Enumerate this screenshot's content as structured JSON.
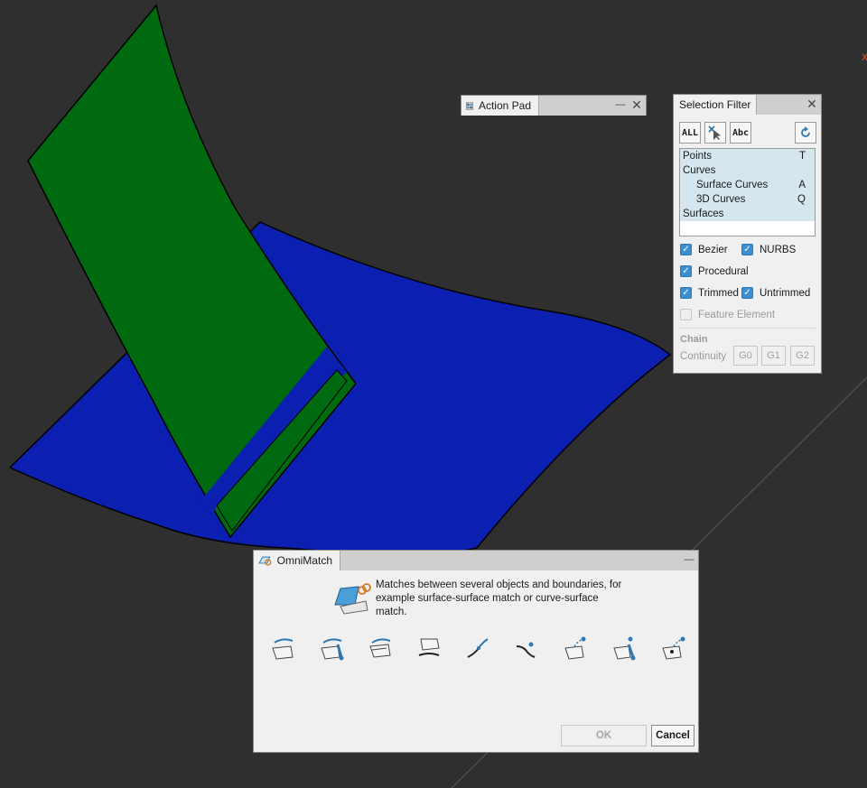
{
  "viewport": {
    "axis_marker": "x"
  },
  "action_pad": {
    "title": "Action Pad",
    "minimize": "—",
    "close": "✕"
  },
  "selection_filter": {
    "title": "Selection Filter",
    "close": "✕",
    "all_button": "ALL",
    "abc_button": "Abc",
    "refresh_icon": "refresh-icon",
    "list": [
      {
        "label": "Points",
        "key": "T"
      },
      {
        "label": "Curves",
        "key": ""
      },
      {
        "label": "Surface Curves",
        "key": "A"
      },
      {
        "label": "3D Curves",
        "key": "Q"
      },
      {
        "label": "Surfaces",
        "key": ""
      }
    ],
    "checks": {
      "bezier": "Bezier",
      "nurbs": "NURBS",
      "procedural": "Procedural",
      "trimmed": "Trimmed",
      "untrimmed": "Untrimmed",
      "feature": "Feature Element"
    },
    "chain_label": "Chain",
    "continuity_label": "Continuity",
    "continuity": [
      "G0",
      "G1",
      "G2"
    ]
  },
  "omnimatch": {
    "title": "OmniMatch",
    "minimize": "—",
    "description_lines": [
      "Matches between several objects and boundaries, for",
      "example surface-surface match or curve-surface",
      "match."
    ],
    "tools": [
      "surface-surface-match-icon",
      "surface-match-brush-icon",
      "multi-surface-match-icon",
      "surface-curve-match-icon",
      "curve-curve-match-icon",
      "curve-point-match-icon",
      "surface-point-match-icon",
      "surface-point-brush-icon",
      "surface-target-match-icon"
    ],
    "ok": "OK",
    "cancel": "Cancel"
  },
  "colors": {
    "background": "#2f2f2f",
    "green_surface": "#006a10",
    "blue_surface": "#0b1fb0",
    "accent": "#3d8fcf"
  }
}
